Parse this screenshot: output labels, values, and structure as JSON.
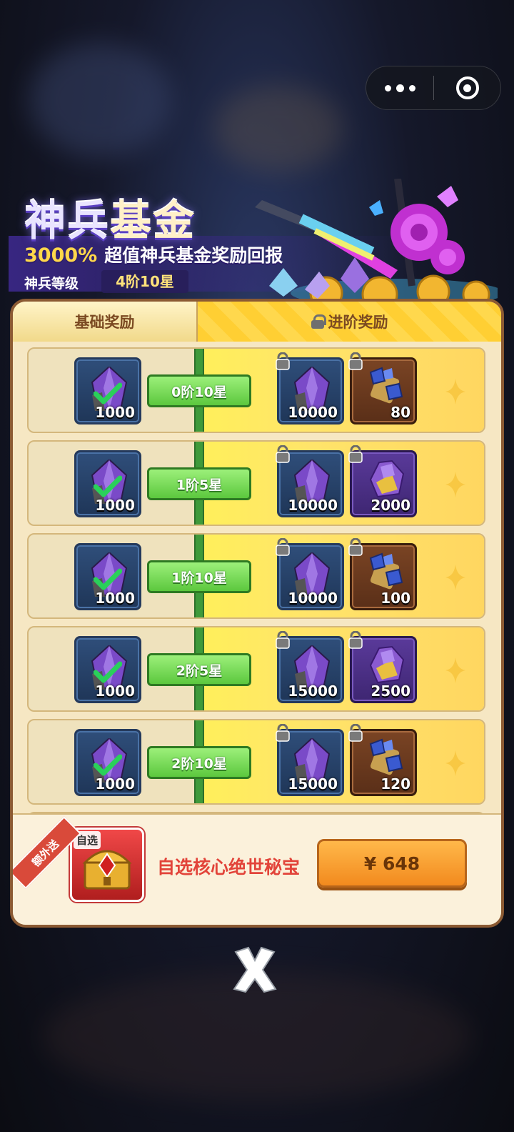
{
  "capsule": {
    "more_icon": "more-dots-icon",
    "close_icon": "close-circle-icon"
  },
  "banner": {
    "title_part1": "神兵",
    "title_part2": "基金",
    "subtitle_pct": "3000%",
    "subtitle_text": "超值神兵基金奖励回报",
    "level_label": "神兵等级",
    "level_value": "4阶10星"
  },
  "tabs": {
    "basic": "基础奖励",
    "advanced": "进阶奖励"
  },
  "rows": [
    {
      "level": "0阶10星",
      "basic_qty": "1000",
      "adv1_qty": "10000",
      "adv2_qty": "80",
      "adv2_type": "ore"
    },
    {
      "level": "1阶5星",
      "basic_qty": "1000",
      "adv1_qty": "10000",
      "adv2_qty": "2000",
      "adv2_type": "crystal"
    },
    {
      "level": "1阶10星",
      "basic_qty": "1000",
      "adv1_qty": "10000",
      "adv2_qty": "100",
      "adv2_type": "ore"
    },
    {
      "level": "2阶5星",
      "basic_qty": "1000",
      "adv1_qty": "15000",
      "adv2_qty": "2500",
      "adv2_type": "crystal"
    },
    {
      "level": "2阶10星",
      "basic_qty": "1000",
      "adv1_qty": "15000",
      "adv2_qty": "120",
      "adv2_type": "ore"
    }
  ],
  "offer": {
    "ribbon": "额外送",
    "chest_tag": "自选",
    "text": "自选核心绝世秘宝",
    "price": "¥ 648"
  },
  "colors": {
    "panel_bg": "#f6e7c3",
    "panel_border": "#8b5a33",
    "track_green": "#3f9a3a",
    "advanced_yellow": "#ffd84d",
    "price_orange": "#f28a1e",
    "offer_red": "#e2443a"
  }
}
